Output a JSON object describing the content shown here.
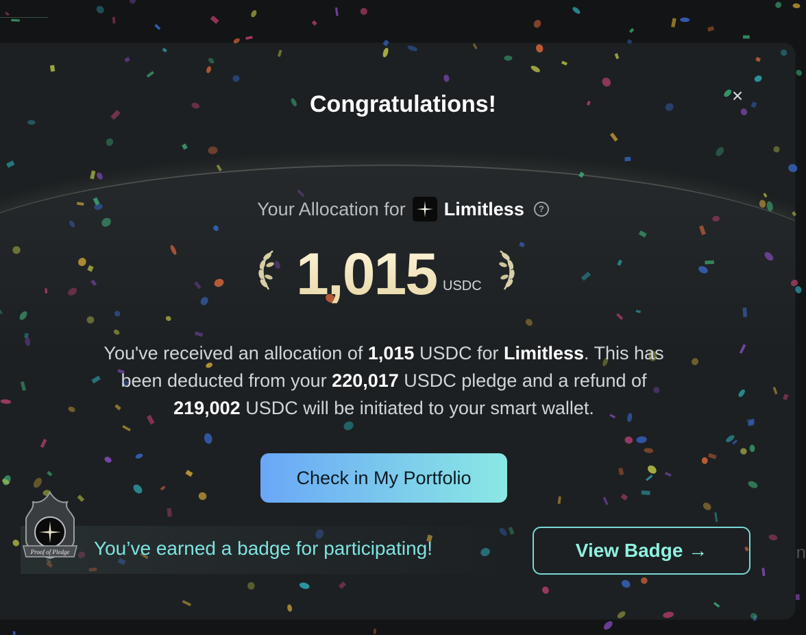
{
  "modal": {
    "title": "Congratulations!",
    "close_glyph": "×",
    "allocation": {
      "prefix": "Your Allocation for",
      "project_logo_icon": "limitless-star-icon",
      "project_name": "Limitless",
      "help_icon": "question-circle-icon",
      "help_glyph": "?",
      "amount": "1,015",
      "unit": "USDC",
      "laurel_icon": "laurel-wreath-icon"
    },
    "description": {
      "part1": "You've received an allocation of ",
      "allocation_amount": "1,015",
      "part2": " USDC for ",
      "project_name": "Limitless",
      "part3": ". This has been deducted from your ",
      "pledge_amount": "220,017",
      "part4": " USDC pledge and a refund of ",
      "refund_amount": "219,002",
      "part5": " USDC will be initiated to your smart wallet."
    },
    "portfolio_button": "Check in My Portfolio",
    "badge": {
      "icon": "proof-of-pledge-badge-icon",
      "badge_label": "Proof of Pledge",
      "text": "You’ve earned a badge for participating!",
      "button": "View Badge →"
    }
  },
  "backdrop": {
    "edge_glyph": "n"
  },
  "colors": {
    "accent_cyan": "#7fe3e0",
    "button_gradient_start": "#6aa7f7",
    "button_gradient_end": "#8ae8e4",
    "amount_gold": "#f3e6bd",
    "modal_bg": "#1c2022"
  }
}
